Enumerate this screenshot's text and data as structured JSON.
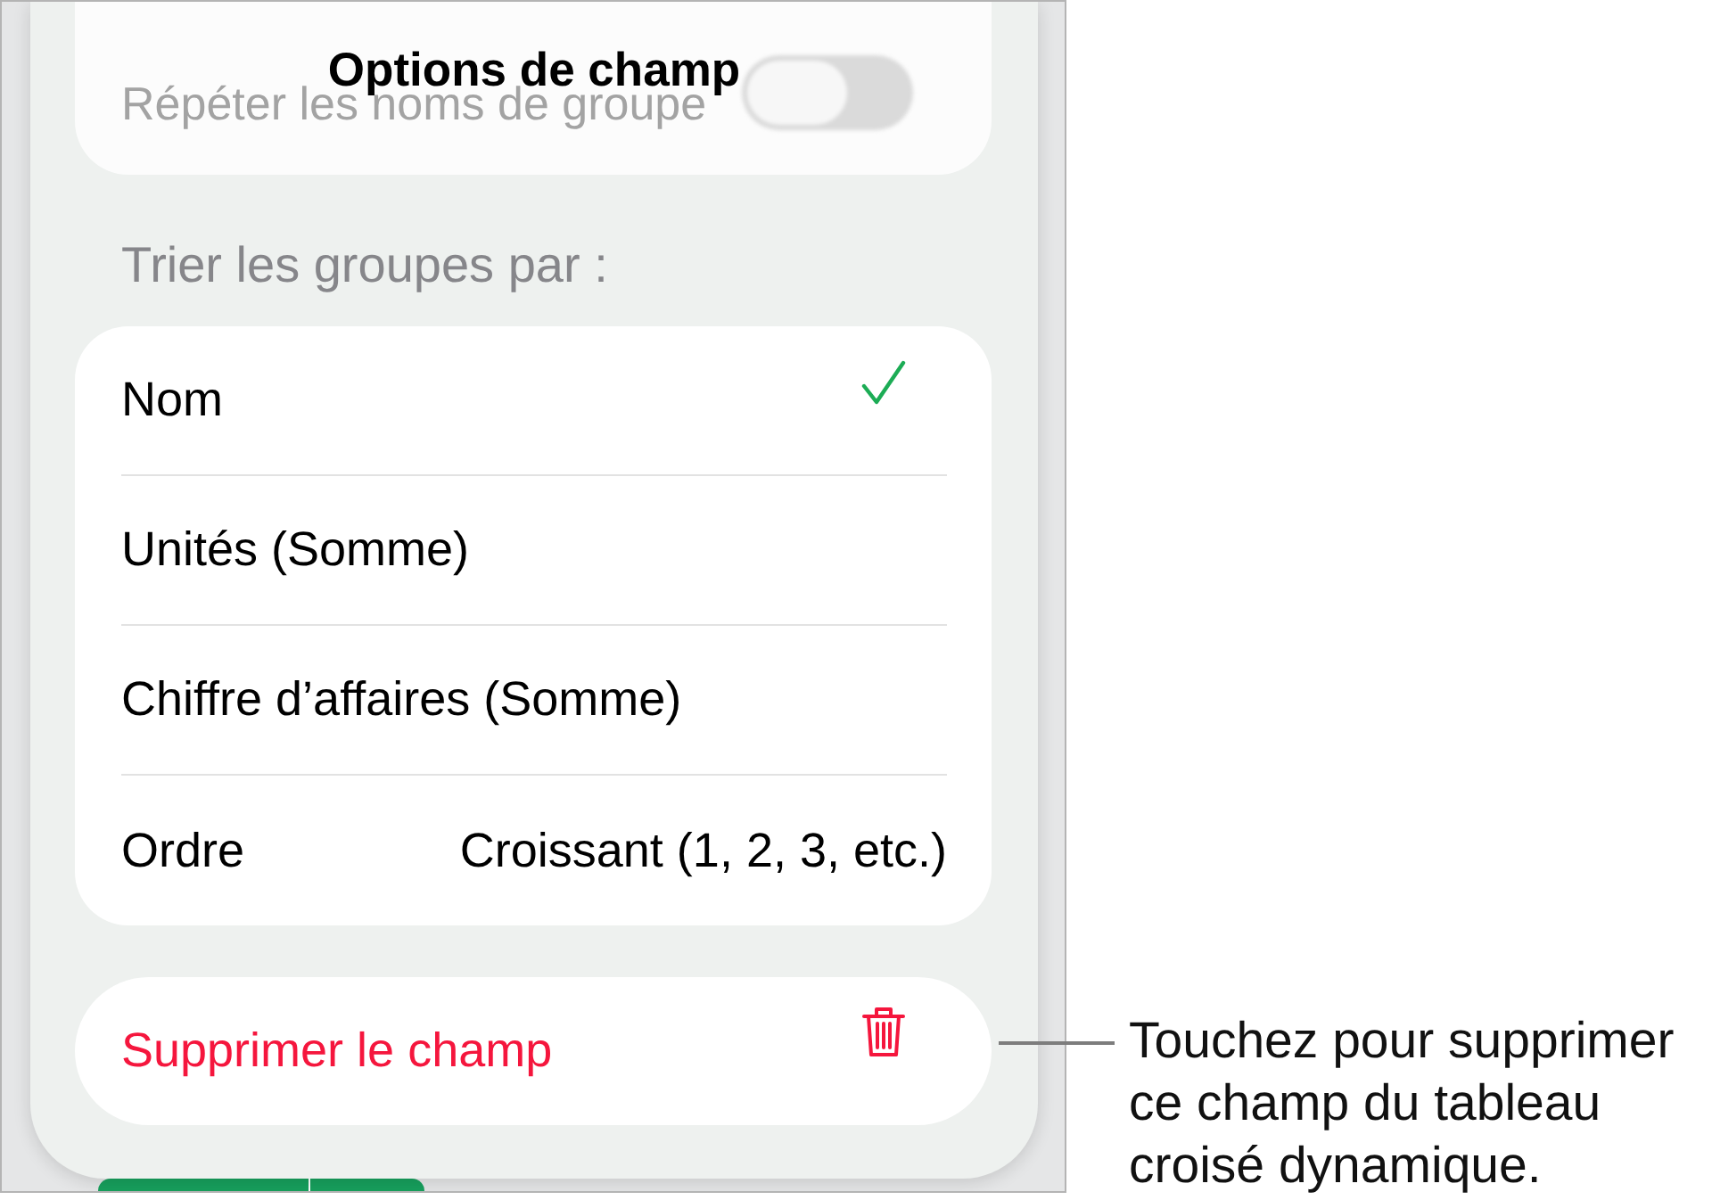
{
  "sheet": {
    "title": "Options de champ"
  },
  "background_row": {
    "label": "Répéter les noms de groupe",
    "toggle": {
      "on": false
    }
  },
  "sort_section": {
    "header": "Trier les groupes par :",
    "options": [
      {
        "label": "Nom",
        "selected": true
      },
      {
        "label": "Unités (Somme)",
        "selected": false
      },
      {
        "label": "Chiffre d’affaires (Somme)",
        "selected": false
      }
    ],
    "order": {
      "label": "Ordre",
      "value": "Croissant (1, 2, 3, etc.)"
    }
  },
  "delete_button": {
    "label": "Supprimer le champ"
  },
  "callout": {
    "text": "Touchez pour supprimer ce champ du tableau croisé dynamique."
  }
}
